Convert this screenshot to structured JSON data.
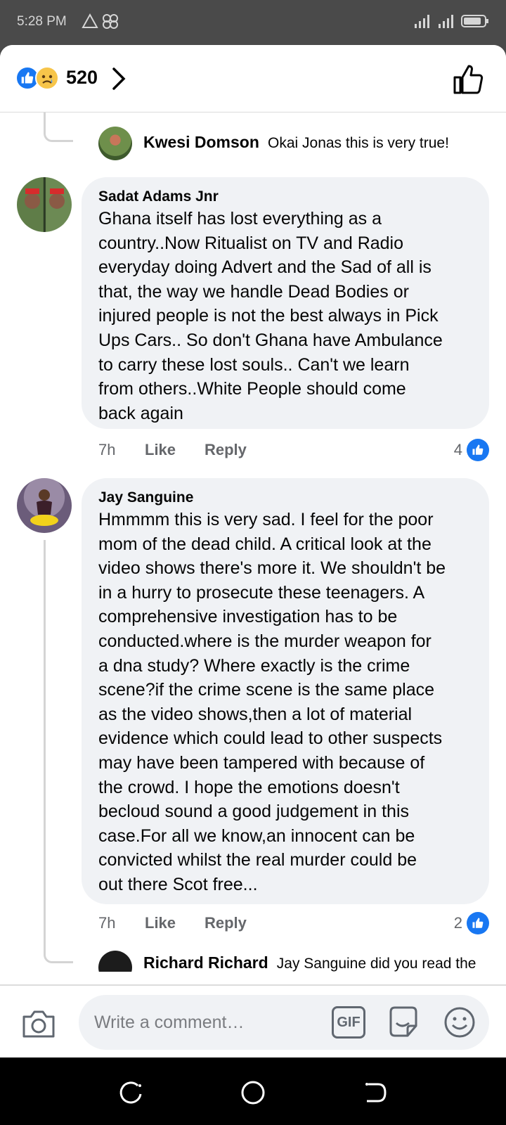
{
  "status_bar": {
    "time": "5:28 PM",
    "left_icons": [
      "warning-triangle-icon",
      "apps-icon"
    ],
    "right_icons": [
      "signal-icon",
      "signal-icon",
      "battery-icon"
    ]
  },
  "reactions": {
    "count": "520",
    "icons": [
      "like-reaction-icon",
      "sad-reaction-icon"
    ]
  },
  "comments": [
    {
      "type": "reply",
      "author": "Kwesi Domson",
      "text": "Okai Jonas this is very true!"
    },
    {
      "type": "comment",
      "author": "Sadat Adams Jnr",
      "text": "Ghana itself has lost everything as a\ncountry..Now Ritualist on TV and Radio\neveryday doing Advert and the Sad of all is\nthat, the way we handle Dead Bodies or\ninjured people is not the best always in Pick\nUps Cars.. So don't Ghana have Ambulance\nto carry these lost souls.. Can't we learn\nfrom others..White People should come\nback again",
      "time": "7h",
      "like_label": "Like",
      "reply_label": "Reply",
      "reaction_count": "4"
    },
    {
      "type": "comment",
      "author": "Jay Sanguine",
      "text": "Hmmmm this is very sad. I feel for the poor\nmom of the dead child. A critical look at the\nvideo shows there's more it. We shouldn't be\nin a hurry to prosecute these teenagers.  A\ncomprehensive investigation has to be\nconducted.where is the murder weapon for\na dna study? Where exactly is the crime\nscene?if the crime scene is the same place\nas the video shows,then a lot of material\nevidence which could lead to other suspects\nmay have been tampered with because of\nthe crowd. I hope the emotions doesn't\nbecloud sound a good judgement in this\ncase.For all we know,an innocent can be\nconvicted whilst the real murder could be\nout there Scot free...",
      "time": "7h",
      "like_label": "Like",
      "reply_label": "Reply",
      "reaction_count": "2"
    },
    {
      "type": "reply",
      "author": "Richard Richard",
      "text": "Jay Sanguine did you read the"
    }
  ],
  "composer": {
    "placeholder": "Write a comment…",
    "gif_label": "GIF"
  },
  "colors": {
    "accent": "#1877f2",
    "bubble": "#f0f2f5",
    "meta_text": "#65676b"
  }
}
